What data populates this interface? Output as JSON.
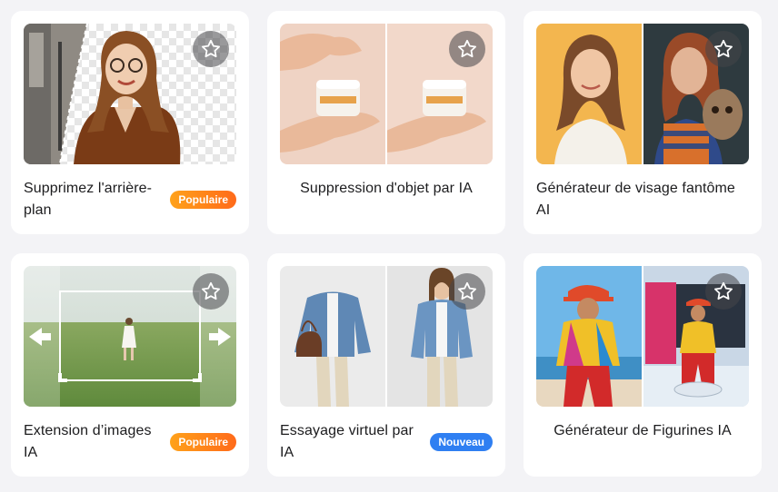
{
  "tools": [
    {
      "title": "Supprimez l'arrière-plan",
      "badge": "Populaire"
    },
    {
      "title": "Suppression d'objet par IA",
      "badge": ""
    },
    {
      "title": "Générateur de visage fantôme AI",
      "badge": ""
    },
    {
      "title": "Extension d’images IA",
      "badge": "Populaire"
    },
    {
      "title": "Essayage virtuel par IA",
      "badge": "Nouveau"
    },
    {
      "title": "Générateur de Figurines IA",
      "badge": ""
    }
  ],
  "colors": {
    "badge_populaire": "#ff8a1a",
    "badge_nouveau": "#2f7ff2",
    "star_button_bg": "#59595b"
  },
  "icons": {
    "favorite": "star-outline-icon"
  }
}
